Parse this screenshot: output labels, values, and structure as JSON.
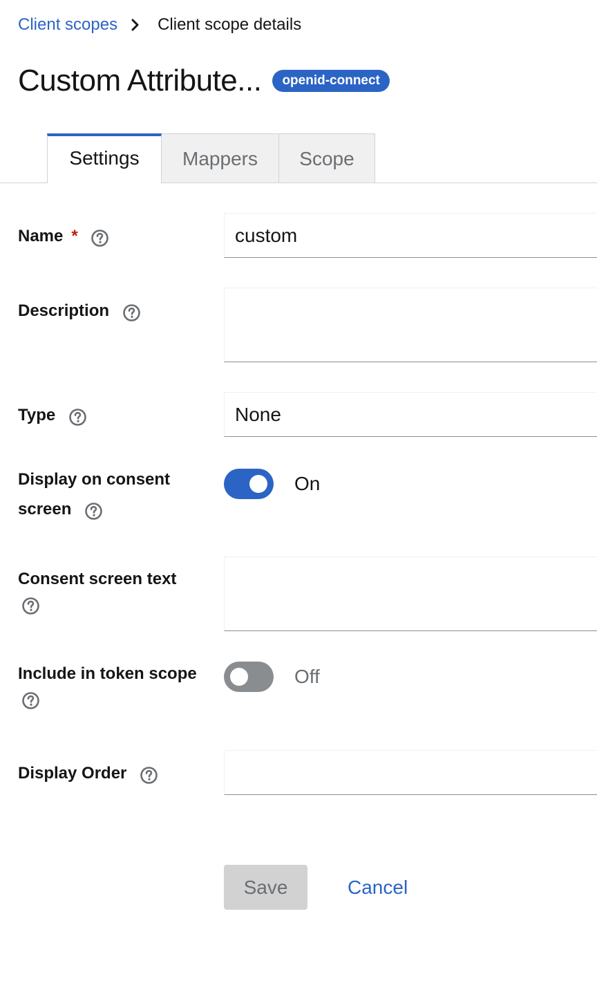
{
  "breadcrumb": {
    "parent": "Client scopes",
    "current": "Client scope details"
  },
  "header": {
    "title": "Custom Attribute...",
    "badge": "openid-connect"
  },
  "tabs": [
    {
      "label": "Settings",
      "active": true
    },
    {
      "label": "Mappers",
      "active": false
    },
    {
      "label": "Scope",
      "active": false
    }
  ],
  "form": {
    "name": {
      "label": "Name",
      "required_mark": "*",
      "value": "custom"
    },
    "description": {
      "label": "Description",
      "value": ""
    },
    "type": {
      "label": "Type",
      "value": "None"
    },
    "display_on_consent": {
      "label_line1": "Display on consent",
      "label_line2": "screen",
      "state": "On",
      "checked": true
    },
    "consent_text": {
      "label": "Consent screen text",
      "value": ""
    },
    "include_token_scope": {
      "label": "Include in token scope",
      "state": "Off",
      "checked": false
    },
    "display_order": {
      "label": "Display Order",
      "value": ""
    }
  },
  "actions": {
    "save": "Save",
    "cancel": "Cancel"
  },
  "colors": {
    "accent": "#2b64c4",
    "required": "#c9190b",
    "switch_off": "#8a8d90"
  },
  "icons": {
    "help": "help-circle-icon",
    "separator": "chevron-right-icon"
  }
}
